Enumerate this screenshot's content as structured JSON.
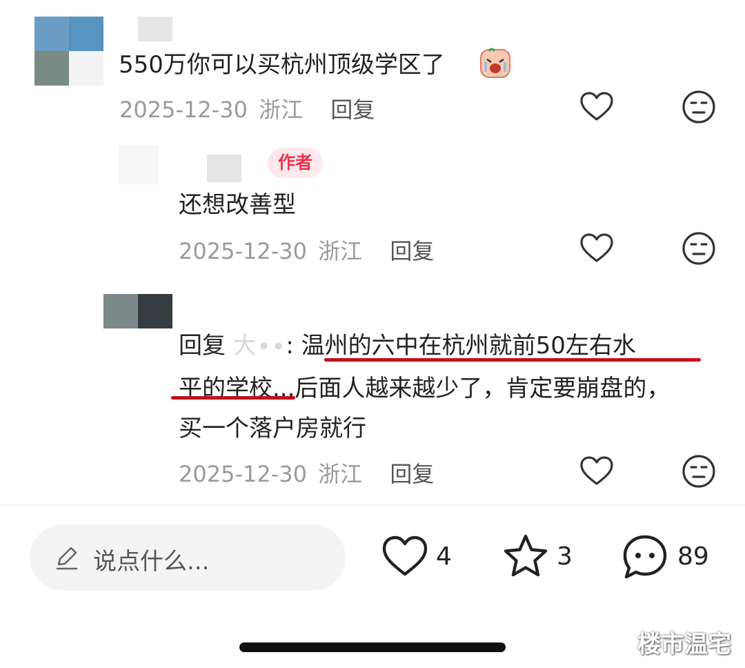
{
  "comments": [
    {
      "text": "550万你可以买杭州顶级学区了",
      "emoji": "crying-face",
      "date": "2025-12-30",
      "location": "浙江",
      "reply_label": "回复"
    },
    {
      "badge": "作者",
      "text": "还想改善型",
      "date": "2025-12-30",
      "location": "浙江",
      "reply_label": "回复"
    },
    {
      "reply_prefix": "回复",
      "reply_name": "大∙∙",
      "separator": ": ",
      "line1": "温州的六中在杭州就前50左右水",
      "line2a": "平的学校",
      "line2b": "...后面人越来越少了，肯定要崩盘的，",
      "line3": "买一个落户房就行",
      "date": "2025-12-30",
      "location": "浙江",
      "reply_label": "回复"
    }
  ],
  "input": {
    "placeholder": "说点什么..."
  },
  "actions": {
    "likes": "4",
    "stars": "3",
    "comments": "89"
  },
  "watermark": "楼市温宅",
  "colors": {
    "highlight_underline": "#c0101c",
    "author_badge_text": "#e8354f",
    "author_badge_bg": "#fde8ec",
    "meta_text": "#9a9a9a"
  }
}
